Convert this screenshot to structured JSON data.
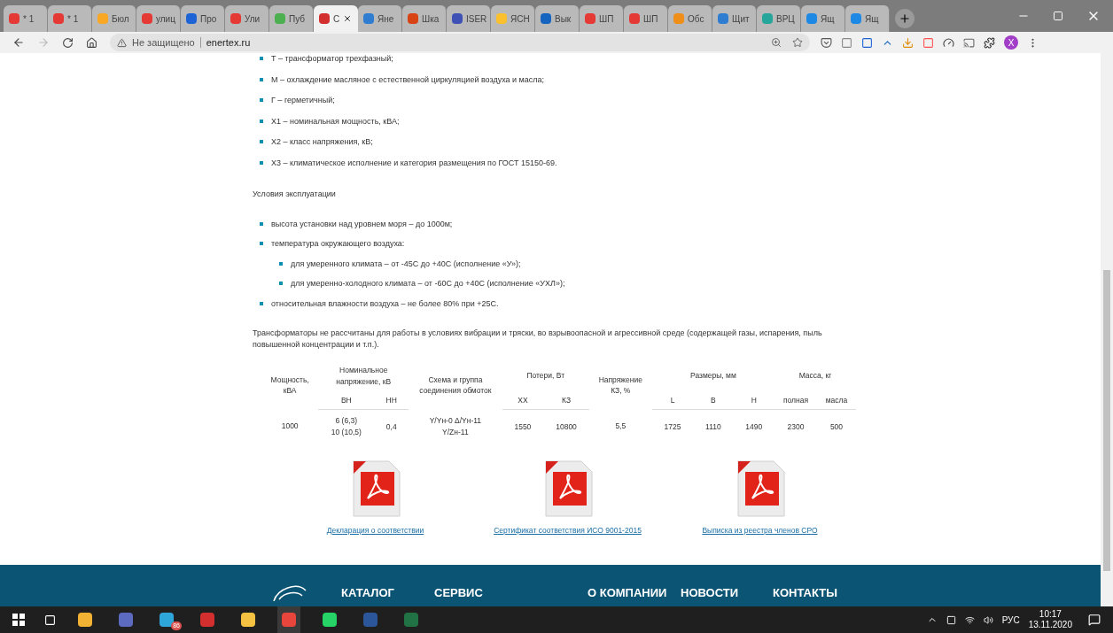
{
  "browser": {
    "tabs": [
      {
        "label": "* 1",
        "selected": false,
        "color": "#e53935"
      },
      {
        "label": "* 1",
        "selected": false,
        "color": "#e53935"
      },
      {
        "label": "Бюл",
        "selected": false,
        "color": "#f9a825"
      },
      {
        "label": "улиц",
        "selected": false,
        "color": "#e53935"
      },
      {
        "label": "Про",
        "selected": false,
        "color": "#1e63d6"
      },
      {
        "label": "Ули",
        "selected": false,
        "color": "#e53935"
      },
      {
        "label": "Пуб",
        "selected": false,
        "color": "#4caf50"
      },
      {
        "label": "С",
        "selected": true,
        "color": "#d32f2f"
      },
      {
        "label": "Яне",
        "selected": false,
        "color": "#2e7dd1"
      },
      {
        "label": "Шка",
        "selected": false,
        "color": "#d84315"
      },
      {
        "label": "ISER",
        "selected": false,
        "color": "#3f51b5"
      },
      {
        "label": "ЯСН",
        "selected": false,
        "color": "#fbc02d"
      },
      {
        "label": "Вык",
        "selected": false,
        "color": "#1565c0"
      },
      {
        "label": "ШП",
        "selected": false,
        "color": "#e53935"
      },
      {
        "label": "ШП",
        "selected": false,
        "color": "#e53935"
      },
      {
        "label": "Обс",
        "selected": false,
        "color": "#ef8f1a"
      },
      {
        "label": "Щит",
        "selected": false,
        "color": "#2e7dd1"
      },
      {
        "label": "ВРЦ",
        "selected": false,
        "color": "#26a69a"
      },
      {
        "label": "Ящ",
        "selected": false,
        "color": "#1e88e5"
      },
      {
        "label": "Ящ",
        "selected": false,
        "color": "#1e88e5"
      }
    ],
    "security": "Не защищено",
    "url": "enertex.ru",
    "avatar": "X"
  },
  "page": {
    "marking_items": [
      "Т – трансформатор трехфазный;",
      "М – охлаждение масляное с естественной циркуляцией воздуха и масла;",
      "Г – герметичный;",
      "Х1 – номинальная мощность, кВА;",
      "Х2 – класс напряжения, кВ;",
      "Х3 – климатическое исполнение и категория размещения по ГОСТ 15150-69."
    ],
    "conditions_title": "Условия эксплуатации",
    "conditions": [
      {
        "text": "высота установки над уровнем моря – до 1000м;"
      },
      {
        "text": "температура окружающего воздуха:",
        "children": [
          {
            "text": "для умеренного климата – от -45С до +40С (исполнение «У»);"
          },
          {
            "text": "для умеренно-холодного климата – от -60С до +40С (исполнение «УХЛ»);"
          }
        ]
      },
      {
        "text": "относительная влажности воздуха – не более 80% при +25С."
      }
    ],
    "note": "Трансформаторы не рассчитаны для работы в условиях вибрации и тряски, во взрывоопасной и агрессивной среде (содержащей газы, испарения, пыль повышенной концентрации и т.п.).",
    "table": {
      "columns": [
        {
          "label": "Мощность,\nкВА"
        },
        {
          "label": "Номинальное\nнапряжение, кВ",
          "colspan": 2,
          "sub": [
            "ВН",
            "НН"
          ]
        },
        {
          "label": "Схема и группа\nсоединения обмоток"
        },
        {
          "label": "Потери, Вт",
          "colspan": 2,
          "sub": [
            "ХХ",
            "КЗ"
          ]
        },
        {
          "label": "Напряжение\nКЗ, %"
        },
        {
          "label": "Размеры, мм",
          "colspan": 3,
          "sub": [
            "L",
            "B",
            "H"
          ]
        },
        {
          "label": "Масса, кг",
          "colspan": 2,
          "sub": [
            "полная",
            "масла"
          ]
        }
      ],
      "rows": [
        [
          "1000",
          "6 (6,3)\n10 (10,5)",
          "0,4",
          "Y/Yн-0 Δ/Yн-11\nY/Zн-11",
          "1550",
          "10800",
          "5,5",
          "1725",
          "1110",
          "1490",
          "2300",
          "500"
        ]
      ]
    },
    "documents": [
      "Декларация о соответствии",
      "Сертификат соответствия ИСО 9001-2015",
      "Выписка из реестра членов СРО"
    ],
    "footer_nav": [
      "КАТАЛОГ",
      "СЕРВИС",
      "О КОМПАНИИ",
      "НОВОСТИ",
      "КОНТАКТЫ"
    ]
  },
  "taskbar": {
    "badge": "86",
    "lang": "РУС",
    "time": "10:17",
    "date": "13.11.2020"
  }
}
